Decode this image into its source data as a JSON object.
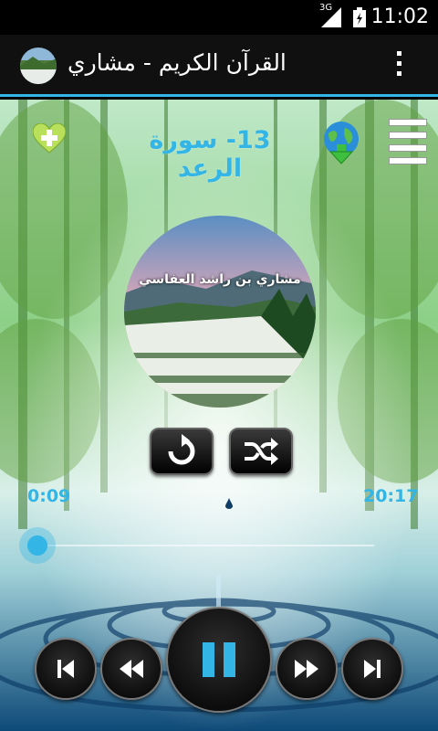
{
  "status_bar": {
    "time": "11:02",
    "network": "3G"
  },
  "app": {
    "title": "القرآن الكريم - مشاري"
  },
  "player": {
    "surah_title": "13- سورة الرعد",
    "reciter": "مشاري بن راشد العفاسي",
    "elapsed": "0:09",
    "duration": "20:17",
    "progress_fraction": 0.0074,
    "is_playing": true
  },
  "colors": {
    "accent": "#33b5e5"
  },
  "icons": {
    "favorite": "heart-plus-icon",
    "download": "globe-download-icon",
    "menu": "list-menu-icon",
    "repeat": "repeat-icon",
    "shuffle": "shuffle-icon",
    "skip_previous": "skip-previous-icon",
    "rewind": "rewind-icon",
    "pause": "pause-icon",
    "fast_forward": "fast-forward-icon",
    "skip_next": "skip-next-icon"
  }
}
